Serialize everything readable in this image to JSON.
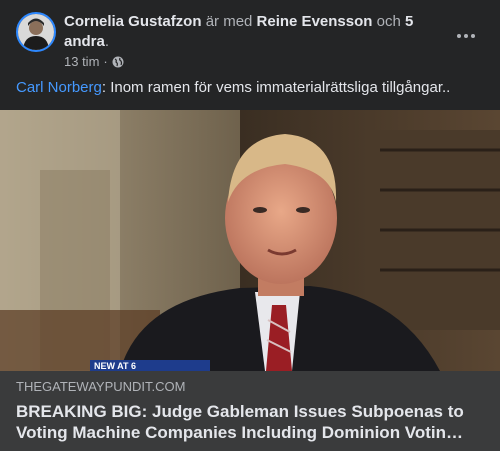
{
  "post": {
    "author": "Cornelia Gustafzon",
    "with_text": "är med",
    "tagged_person": "Reine Evensson",
    "and_text": "och",
    "others": "5 andra",
    "period": ".",
    "timestamp": "13 tim",
    "separator": "·",
    "privacy_icon": "globe-icon",
    "caption_mention": "Carl Norberg",
    "caption_text": ": Inom ramen för vems immaterialrättsliga tillgångar.."
  },
  "link_preview": {
    "image_overlay_text": "NEW AT 6",
    "domain": "THEGATEWAYPUNDIT.COM",
    "title_line1": "BREAKING BIG: Judge Gableman Issues Subpoenas to",
    "title_line2": "Voting Machine Companies Including Dominion Votin…"
  },
  "colors": {
    "background": "#242526",
    "link_blue": "#4599ff",
    "text_primary": "#e4e6eb",
    "text_secondary": "#b0b3b8",
    "preview_bg": "#3a3b3c"
  }
}
